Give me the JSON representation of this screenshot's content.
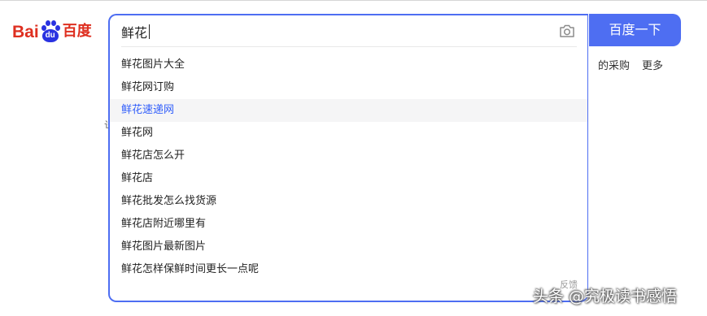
{
  "logo": {
    "latin_prefix": "Bai",
    "paw_text": "du",
    "chinese": "百度"
  },
  "search": {
    "value": "鲜花",
    "button_label": "百度一下",
    "camera_icon": "camera-icon"
  },
  "suggestions": [
    "鲜花图片大全",
    "鲜花网订购",
    "鲜花速递网",
    "鲜花网",
    "鲜花店怎么开",
    "鲜花店",
    "鲜花批发怎么找货源",
    "鲜花店附近哪里有",
    "鲜花图片最新图片",
    "鲜花怎样保鲜时间更长一点呢"
  ],
  "active_suggestion_index": 2,
  "feedback_label": "反馈",
  "nav": {
    "partial_label": "的采购",
    "more_label": "更多"
  },
  "watermark": "头条 @究极读书感悟",
  "colors": {
    "brand_blue": "#4e6ef2",
    "logo_red": "#de2f20",
    "paw_blue": "#2932e1",
    "active_text": "#315efb"
  }
}
